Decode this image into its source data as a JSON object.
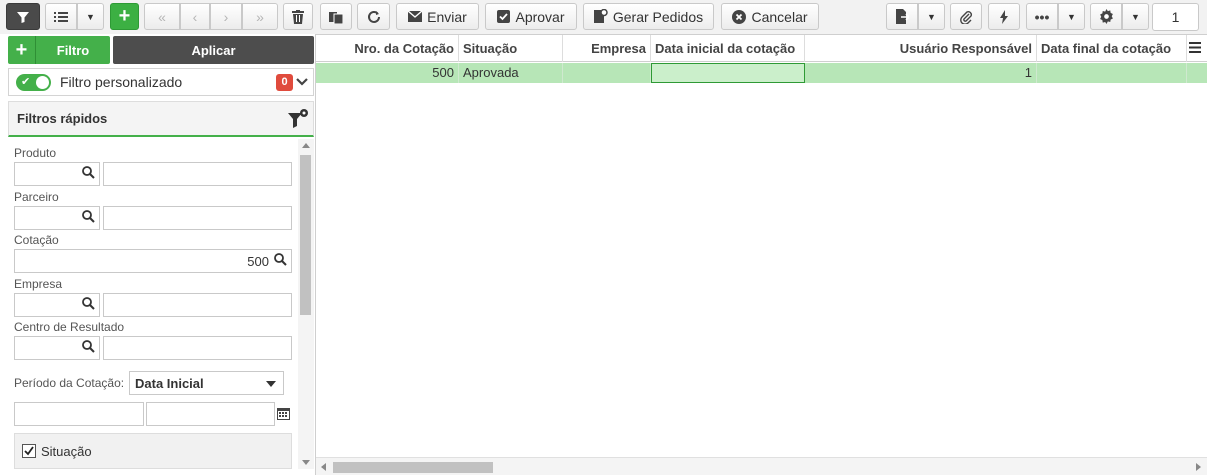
{
  "toolbar": {
    "enviar_label": "Enviar",
    "aprovar_label": "Aprovar",
    "gerar_pedidos_label": "Gerar Pedidos",
    "cancelar_label": "Cancelar",
    "page_number": "1"
  },
  "left": {
    "filtro_label": "Filtro",
    "aplicar_label": "Aplicar",
    "custom_filter_label": "Filtro personalizado",
    "custom_filter_count": "0",
    "quick_filters_title": "Filtros rápidos",
    "fields": {
      "produto": "Produto",
      "parceiro": "Parceiro",
      "cotacao": "Cotação",
      "cotacao_value": "500",
      "empresa": "Empresa",
      "centro": "Centro de Resultado",
      "periodo": "Período da Cotação:",
      "periodo_selected": "Data Inicial",
      "situacao": "Situação"
    }
  },
  "grid": {
    "columns": [
      "Nro. da Cotação",
      "Situação",
      "Empresa",
      "Data inicial da cotação",
      "Usuário Responsável",
      "Data final da cotação"
    ],
    "rows": [
      {
        "nro": "500",
        "situacao": "Aprovada",
        "empresa": "",
        "data_inicial": "",
        "usuario": "1",
        "data_final": ""
      }
    ]
  },
  "colors": {
    "accent_green": "#44b04a",
    "row_selected": "#b7e6b7",
    "badge_red": "#e04b3d"
  }
}
